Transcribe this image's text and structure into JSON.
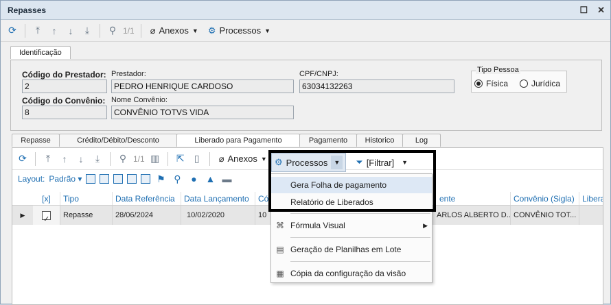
{
  "window": {
    "title": "Repasses"
  },
  "toolbar": {
    "pager": "1/1",
    "anexos": "Anexos",
    "processos": "Processos"
  },
  "ident_tab": "Identificação",
  "fields": {
    "codigo_prestador_label": "Código do Prestador:",
    "codigo_prestador": "2",
    "prestador_label": "Prestador:",
    "prestador": "PEDRO HENRIQUE CARDOSO",
    "cpf_label": "CPF/CNPJ:",
    "cpf": "63034132263",
    "codigo_convenio_label": "Código do Convênio:",
    "codigo_convenio": "8",
    "nome_convenio_label": "Nome Convênio:",
    "nome_convenio": "CONVÊNIO TOTVS  VIDA",
    "tipo_pessoa_label": "Tipo Pessoa",
    "fisica": "Física",
    "juridica": "Jurídica"
  },
  "inner_tabs": [
    "Repasse",
    "Crédito/Débito/Desconto",
    "Liberado para Pagamento",
    "Pagamento",
    "Historico",
    "Log"
  ],
  "inner_toolbar": {
    "pager": "1/1",
    "anexos": "Anexos",
    "processos": "Processos",
    "filtrar": "[Filtrar]"
  },
  "layout_bar": {
    "layout_label": "Layout:",
    "padrao": "Padrão"
  },
  "grid": {
    "headers": [
      "[x]",
      "Tipo",
      "Data Referência",
      "Data Lançamento",
      "Cód",
      "ente",
      "Convênio (Sigla)",
      "Libera"
    ],
    "row": {
      "tipo": "Repasse",
      "data_ref": "28/06/2024",
      "data_lanc": "10/02/2020",
      "cod": "10",
      "ente": "ARLOS ALBERTO D...",
      "convenio": "CONVÊNIO TOT..."
    }
  },
  "menu": {
    "items": [
      "Gera Folha de pagamento",
      "Relatório de Liberados",
      "Fórmula Visual",
      "Geração de Planilhas em Lote",
      "Cópia da configuração da visão"
    ]
  },
  "colors": {
    "accent": "#1f6fb2",
    "highlight": "#dde8f5",
    "callout": "#000000"
  }
}
